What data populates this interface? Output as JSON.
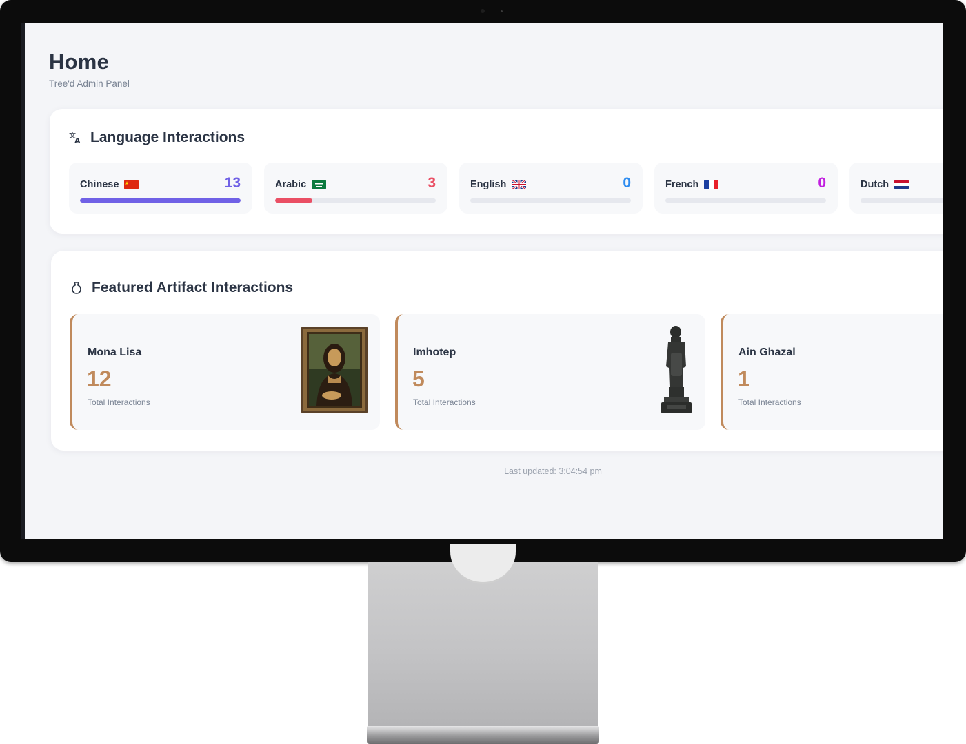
{
  "page": {
    "title": "Home",
    "subtitle": "Tree'd Admin Panel"
  },
  "languages": {
    "title": "Language Interactions",
    "icon": "translate-icon",
    "items": [
      {
        "name": "Chinese",
        "count": "13",
        "fraction": 1.0,
        "color": "#7061e6",
        "flag": "china-flag-icon"
      },
      {
        "name": "Arabic",
        "count": "3",
        "fraction": 0.23,
        "color": "#ea4f64",
        "flag": "saudi-flag-icon"
      },
      {
        "name": "English",
        "count": "0",
        "fraction": 0.0,
        "color": "#2d8cf0",
        "flag": "uk-flag-icon"
      },
      {
        "name": "French",
        "count": "0",
        "fraction": 0.0,
        "color": "#c21fe0",
        "flag": "france-flag-icon"
      },
      {
        "name": "Dutch",
        "count": "",
        "fraction": 0.0,
        "color": "#2d8cf0",
        "flag": "netherlands-flag-icon"
      }
    ]
  },
  "artifacts": {
    "title": "Featured Artifact Interactions",
    "icon": "vase-icon",
    "items": [
      {
        "name": "Mona Lisa",
        "count": "12",
        "label": "Total Interactions",
        "image": "mona-lisa-painting-icon"
      },
      {
        "name": "Imhotep",
        "count": "5",
        "label": "Total Interactions",
        "image": "imhotep-statue-icon"
      },
      {
        "name": "Ain Ghazal",
        "count": "1",
        "label": "Total Interactions",
        "image": ""
      }
    ],
    "accent": "#c08a5c"
  },
  "footer": {
    "updated": "Last updated: 3:04:54 pm"
  }
}
